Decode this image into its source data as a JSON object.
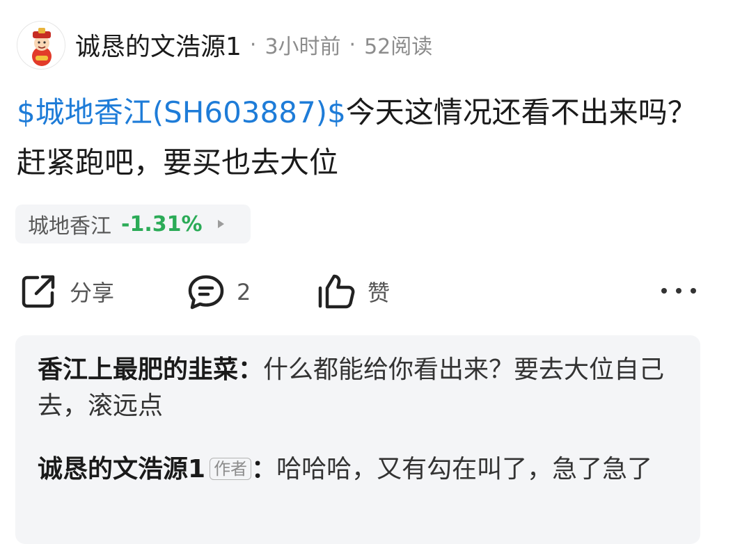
{
  "post": {
    "author": "诚恳的文浩源1",
    "time": "3小时前",
    "reads": "52阅读",
    "separator": "·",
    "stock_link": "$城地香江(SH603887)$",
    "text": "今天这情况还看不出来吗？赶紧跑吧，要买也去大位"
  },
  "stock_chip": {
    "name": "城地香江",
    "change": "-1.31%",
    "change_color": "#2bab57"
  },
  "actions": {
    "share_label": "分享",
    "comment_count": "2",
    "like_label": "赞",
    "share_icon": "share-icon",
    "comment_icon": "comment-icon",
    "like_icon": "thumbs-up-icon",
    "more_icon": "more-icon"
  },
  "comments": [
    {
      "user": "香江上最肥的韭菜",
      "colon": "：",
      "text": "什么都能给你看出来？要去大位自己去，滚远点"
    },
    {
      "user": "诚恳的文浩源1",
      "tag": "作者",
      "colon": "：",
      "text": "哈哈哈，又有勾在叫了，急了急了"
    }
  ],
  "colors": {
    "link": "#1e7cd8",
    "down": "#2bab57",
    "panel_bg": "#f4f5f7"
  }
}
